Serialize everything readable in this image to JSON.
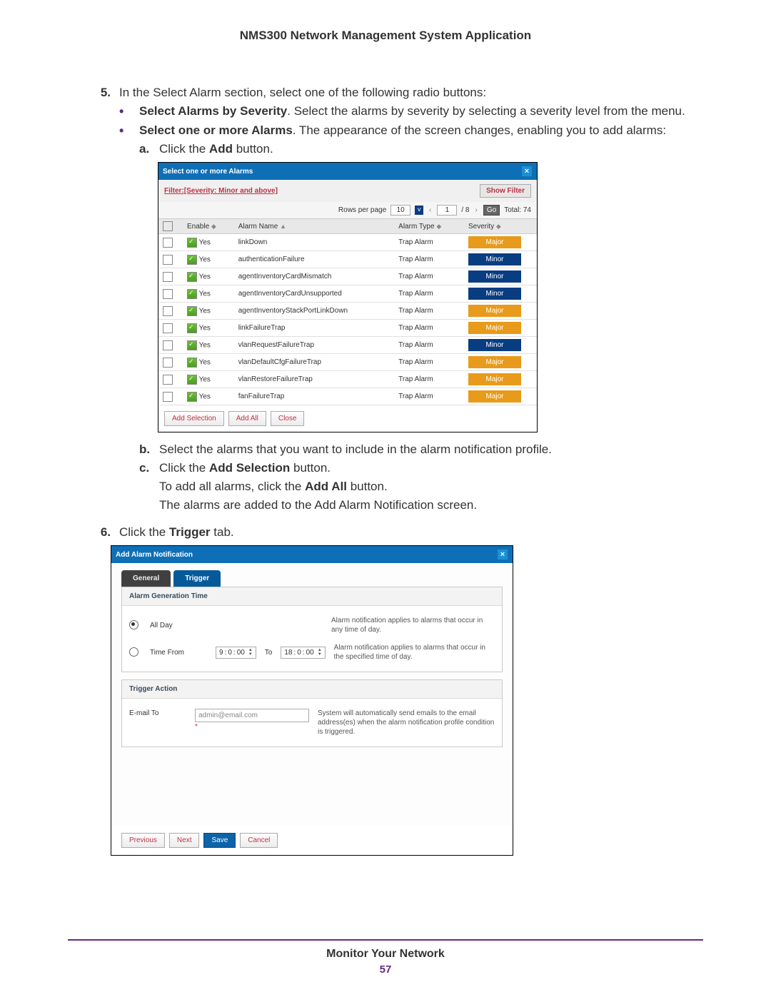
{
  "doc": {
    "title": "NMS300 Network Management System Application",
    "footer_title": "Monitor Your Network",
    "page_number": "57"
  },
  "text": {
    "step5_num": "5.",
    "step5": "In the Select Alarm section, select one of the following radio buttons:",
    "b1_label": "Select Alarms by Severity",
    "b1_text": ". Select the alarms by severity by selecting a severity level from the menu.",
    "b2_label": "Select one or more Alarms",
    "b2_text": ". The appearance of the screen changes, enabling you to add alarms:",
    "a_marker": "a.",
    "a_pre": "Click the ",
    "a_bold": "Add",
    "a_post": " button.",
    "b_marker": "b.",
    "b_text": "Select the alarms that you want to include in the alarm notification profile.",
    "c_marker": "c.",
    "c_pre": "Click the ",
    "c_bold": "Add Selection",
    "c_post": " button.",
    "addall_pre": "To add all alarms, click the ",
    "addall_bold": "Add All",
    "addall_post": " button.",
    "added_text": "The alarms are added to the Add Alarm Notification screen.",
    "step6_num": "6.",
    "step6_pre": "Click the ",
    "step6_bold": "Trigger",
    "step6_post": " tab."
  },
  "dlg1": {
    "title": "Select one or more Alarms",
    "filter_label": "Filter:[Severity: Minor and above]",
    "show_filter": "Show Filter",
    "rows_label": "Rows per page",
    "rows_value": "10",
    "page_current": "1",
    "page_total": "/ 8",
    "go": "Go",
    "total": "Total: 74",
    "cols": {
      "enable": "Enable",
      "name": "Alarm Name",
      "type": "Alarm Type",
      "severity": "Severity"
    },
    "yes": "Yes",
    "rows": [
      {
        "name": "linkDown",
        "type": "Trap Alarm",
        "severity": "Major"
      },
      {
        "name": "authenticationFailure",
        "type": "Trap Alarm",
        "severity": "Minor"
      },
      {
        "name": "agentInventoryCardMismatch",
        "type": "Trap Alarm",
        "severity": "Minor"
      },
      {
        "name": "agentInventoryCardUnsupported",
        "type": "Trap Alarm",
        "severity": "Minor"
      },
      {
        "name": "agentInventoryStackPortLinkDown",
        "type": "Trap Alarm",
        "severity": "Major"
      },
      {
        "name": "linkFailureTrap",
        "type": "Trap Alarm",
        "severity": "Major"
      },
      {
        "name": "vlanRequestFailureTrap",
        "type": "Trap Alarm",
        "severity": "Minor"
      },
      {
        "name": "vlanDefaultCfgFailureTrap",
        "type": "Trap Alarm",
        "severity": "Major"
      },
      {
        "name": "vlanRestoreFailureTrap",
        "type": "Trap Alarm",
        "severity": "Major"
      },
      {
        "name": "fanFailureTrap",
        "type": "Trap Alarm",
        "severity": "Major"
      }
    ],
    "buttons": {
      "add_sel": "Add Selection",
      "add_all": "Add All",
      "close": "Close"
    }
  },
  "dlg2": {
    "title": "Add Alarm Notification",
    "tab_general": "General",
    "tab_trigger": "Trigger",
    "panel1_title": "Alarm Generation Time",
    "all_day": "All Day",
    "all_day_hint": "Alarm notification applies to alarms that occur in any time of day.",
    "time_from": "Time From",
    "time_from_val_h": "9",
    "time_from_val_m": "0",
    "time_from_val_s": "00",
    "time_to_lbl": "To",
    "time_to_val_h": "18",
    "time_to_val_m": "0",
    "time_to_val_s": "00",
    "time_hint": "Alarm notification applies to alarms that occur in the specified time of day.",
    "panel2_title": "Trigger Action",
    "email_to": "E-mail To",
    "email_placeholder": "admin@email.com",
    "email_hint": "System will automatically send emails to the email address(es) when the alarm notification profile condition is triggered.",
    "buttons": {
      "prev": "Previous",
      "next": "Next",
      "save": "Save",
      "cancel": "Cancel"
    }
  }
}
